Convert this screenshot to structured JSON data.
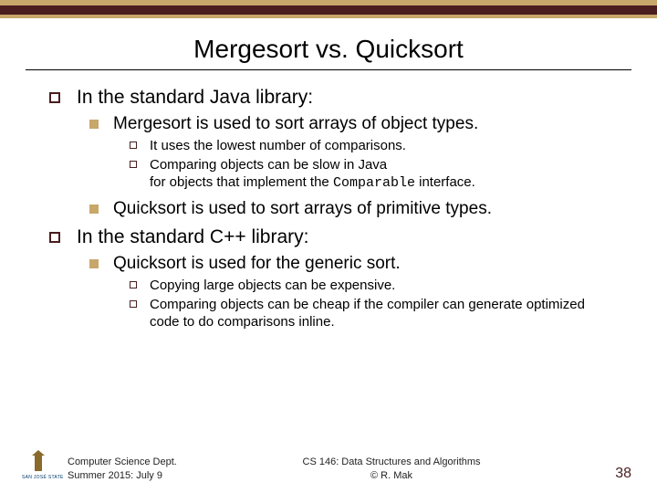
{
  "title": "Mergesort vs. Quicksort",
  "sections": [
    {
      "heading": "In the standard Java library:",
      "items": [
        {
          "text": "Mergesort is used to sort arrays of object types.",
          "sub": [
            "It uses the lowest number of comparisons.",
            "Comparing objects can be slow in Java\nfor objects that implement the Comparable interface."
          ]
        },
        {
          "text": "Quicksort is used to sort arrays of primitive types.",
          "sub": []
        }
      ]
    },
    {
      "heading": "In the standard C++ library:",
      "items": [
        {
          "text": "Quicksort is used for the generic sort.",
          "sub": [
            "Copying large objects can be expensive.",
            "Comparing objects can be cheap if the compiler can generate optimized code to do comparisons inline."
          ]
        }
      ]
    }
  ],
  "footer": {
    "left_line1": "Computer Science Dept.",
    "left_line2": "Summer 2015: July 9",
    "center_line1": "CS 146: Data Structures and Algorithms",
    "center_line2": "© R. Mak",
    "page_number": "38",
    "logo_text": "SAN JOSÉ STATE"
  },
  "code_word": "Comparable"
}
